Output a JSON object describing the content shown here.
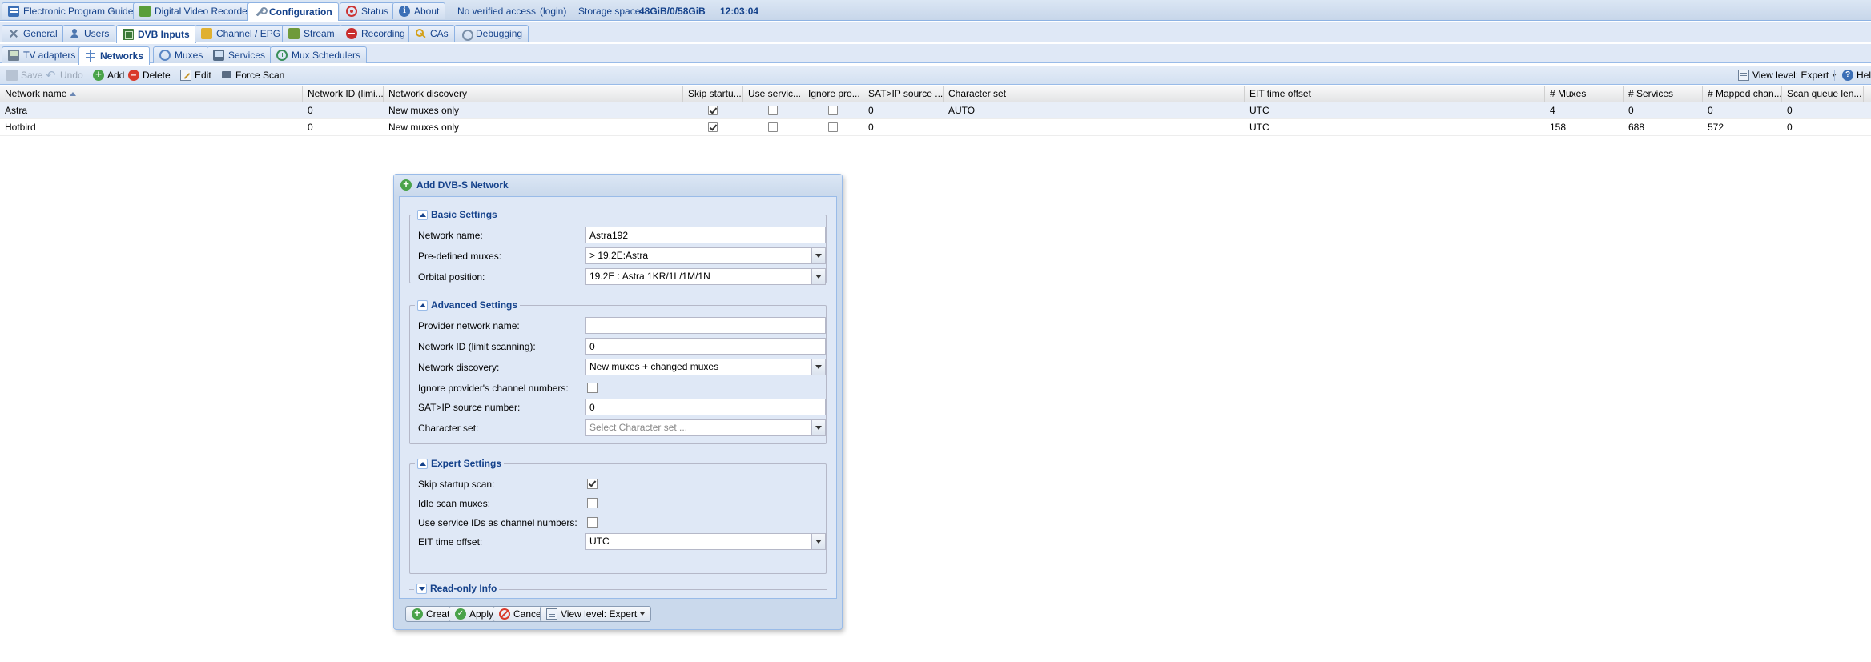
{
  "top_tabs": {
    "epg": "Electronic Program Guide",
    "dvr": "Digital Video Recorder",
    "configuration": "Configuration",
    "status": "Status",
    "about": "About"
  },
  "top_info": {
    "access": "No verified access",
    "login": "(login)",
    "storage_label": "Storage space:",
    "storage_value": "48GiB/0/58GiB",
    "time": "12:03:04"
  },
  "config_tabs": {
    "general": "General",
    "users": "Users",
    "dvb_inputs": "DVB Inputs",
    "channel_epg": "Channel / EPG",
    "stream": "Stream",
    "recording": "Recording",
    "cas": "CAs",
    "debugging": "Debugging"
  },
  "dvb_tabs": {
    "tv_adapters": "TV adapters",
    "networks": "Networks",
    "muxes": "Muxes",
    "services": "Services",
    "mux_schedulers": "Mux Schedulers"
  },
  "toolbar": {
    "save": "Save",
    "undo": "Undo",
    "add": "Add",
    "delete": "Delete",
    "edit": "Edit",
    "force_scan": "Force Scan",
    "view_level": "View level: Expert",
    "help": "Help"
  },
  "grid": {
    "columns": [
      "Network name",
      "Network ID (limi...",
      "Network discovery",
      "Skip startu...",
      "Use servic...",
      "Ignore pro...",
      "SAT>IP source ...",
      "Character set",
      "EIT time offset",
      "# Muxes",
      "# Services",
      "# Mapped chan...",
      "Scan queue len..."
    ],
    "rows": [
      {
        "name": "Astra",
        "network_id": "0",
        "discovery": "New muxes only",
        "skip_startup": true,
        "use_service_ids": false,
        "ignore_provider": false,
        "satip_source": "0",
        "charset": "AUTO",
        "eit_offset": "UTC",
        "muxes": "4",
        "services": "0",
        "mapped": "0",
        "scan_queue": "0"
      },
      {
        "name": "Hotbird",
        "network_id": "0",
        "discovery": "New muxes only",
        "skip_startup": true,
        "use_service_ids": false,
        "ignore_provider": false,
        "satip_source": "0",
        "charset": "",
        "eit_offset": "UTC",
        "muxes": "158",
        "services": "688",
        "mapped": "572",
        "scan_queue": "0"
      }
    ]
  },
  "dialog": {
    "title": "Add DVB-S Network",
    "basic": {
      "legend": "Basic Settings",
      "network_name_label": "Network name:",
      "network_name_value": "Astra192",
      "predefined_label": "Pre-defined muxes:",
      "predefined_value": "> 19.2E:Astra",
      "orbital_label": "Orbital position:",
      "orbital_value": "19.2E : Astra 1KR/1L/1M/1N"
    },
    "advanced": {
      "legend": "Advanced Settings",
      "provider_label": "Provider network name:",
      "provider_value": "",
      "network_id_label": "Network ID (limit scanning):",
      "network_id_value": "0",
      "discovery_label": "Network discovery:",
      "discovery_value": "New muxes + changed muxes",
      "ignore_label": "Ignore provider's channel numbers:",
      "ignore_checked": false,
      "satip_label": "SAT>IP source number:",
      "satip_value": "0",
      "charset_label": "Character set:",
      "charset_placeholder": "Select Character set ..."
    },
    "expert": {
      "legend": "Expert Settings",
      "skip_label": "Skip startup scan:",
      "skip_checked": true,
      "idle_label": "Idle scan muxes:",
      "idle_checked": false,
      "use_sid_label": "Use service IDs as channel numbers:",
      "use_sid_checked": false,
      "eit_label": "EIT time offset:",
      "eit_value": "UTC"
    },
    "readonly_legend": "Read-only Info",
    "buttons": {
      "create": "Create",
      "apply": "Apply",
      "cancel": "Cancel",
      "view_level": "View level: Expert"
    }
  }
}
